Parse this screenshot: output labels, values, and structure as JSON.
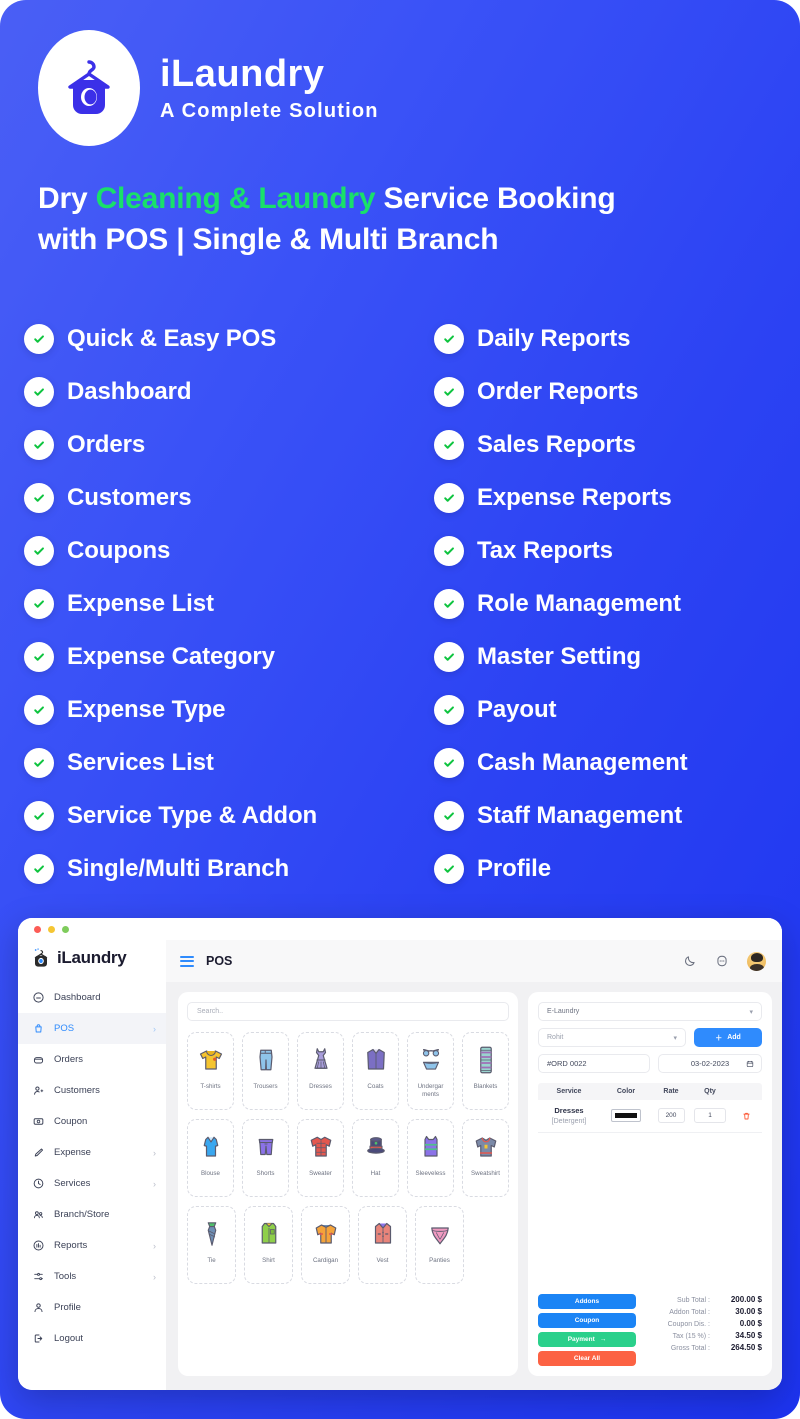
{
  "brand": {
    "logo_icon": "laundry-bag-hanger-icon",
    "name": "iLaundry",
    "tagline": "A Complete Solution"
  },
  "headline": {
    "part1": "Dry ",
    "highlight": "Cleaning & Laundry",
    "part2": " Service Booking",
    "line2": "with POS | Single & Multi Branch",
    "highlight_color": "#19e06a",
    "text_color": "#ffffff"
  },
  "features": {
    "check_icon": "check-circle-icon",
    "left": [
      "Quick & Easy POS",
      "Dashboard",
      "Orders",
      "Customers",
      "Coupons",
      "Expense List",
      "Expense Category",
      "Expense Type",
      "Services List",
      "Service Type & Addon",
      "Single/Multi Branch"
    ],
    "right": [
      "Daily Reports",
      "Order Reports",
      "Sales Reports",
      "Expense Reports",
      "Tax Reports",
      "Role Management",
      "Master Setting",
      "Payout",
      "Cash Management",
      "Staff Management",
      "Profile"
    ]
  },
  "app": {
    "window_dots": [
      "close",
      "minimize",
      "maximize"
    ],
    "sidebar": {
      "brand_name": "iLaundry",
      "brand_icon": "laundry-bag-icon",
      "items": [
        {
          "label": "Dashboard",
          "icon": "dashboard-icon",
          "active": false,
          "chevron": ""
        },
        {
          "label": "POS",
          "icon": "pos-bag-icon",
          "active": true,
          "chevron": "›"
        },
        {
          "label": "Orders",
          "icon": "orders-basket-icon",
          "active": false,
          "chevron": ""
        },
        {
          "label": "Customers",
          "icon": "customers-icon",
          "active": false,
          "chevron": ""
        },
        {
          "label": "Coupon",
          "icon": "coupon-icon",
          "active": false,
          "chevron": ""
        },
        {
          "label": "Expense",
          "icon": "expense-pen-icon",
          "active": false,
          "chevron": "›"
        },
        {
          "label": "Services",
          "icon": "services-clock-icon",
          "active": false,
          "chevron": "›"
        },
        {
          "label": "Branch/Store",
          "icon": "branch-group-icon",
          "active": false,
          "chevron": ""
        },
        {
          "label": "Reports",
          "icon": "reports-chart-icon",
          "active": false,
          "chevron": "›"
        },
        {
          "label": "Tools",
          "icon": "tools-sliders-icon",
          "active": false,
          "chevron": "›"
        },
        {
          "label": "Profile",
          "icon": "profile-user-icon",
          "active": false,
          "chevron": ""
        },
        {
          "label": "Logout",
          "icon": "logout-icon",
          "active": false,
          "chevron": ""
        }
      ]
    },
    "topbar": {
      "menu_icon": "hamburger-icon",
      "title": "POS",
      "dark_mode_icon": "moon-icon",
      "messages_icon": "message-icon",
      "avatar": "user-avatar"
    },
    "products_panel": {
      "search_placeholder": "Search..",
      "rows": [
        [
          {
            "name": "T-shirts",
            "icon": "tshirt-icon"
          },
          {
            "name": "Trousers",
            "icon": "trousers-icon"
          },
          {
            "name": "Dresses",
            "icon": "dress-icon"
          },
          {
            "name": "Coats",
            "icon": "coat-icon"
          },
          {
            "name": "Undergar ments",
            "icon": "underwear-icon"
          },
          {
            "name": "Blankets",
            "icon": "blanket-icon"
          }
        ],
        [
          {
            "name": "Blouse",
            "icon": "blouse-icon"
          },
          {
            "name": "Shorts",
            "icon": "shorts-icon"
          },
          {
            "name": "Sweater",
            "icon": "sweater-icon"
          },
          {
            "name": "Hat",
            "icon": "hat-icon"
          },
          {
            "name": "Sleeveless",
            "icon": "sleeveless-icon"
          },
          {
            "name": "Sweatshirt",
            "icon": "sweatshirt-icon"
          }
        ],
        [
          {
            "name": "Tie",
            "icon": "tie-icon"
          },
          {
            "name": "Shirt",
            "icon": "shirt-icon"
          },
          {
            "name": "Cardigan",
            "icon": "cardigan-icon"
          },
          {
            "name": "Vest",
            "icon": "vest-icon"
          },
          {
            "name": "Panties",
            "icon": "panties-icon"
          }
        ]
      ]
    },
    "cart_panel": {
      "service_select": "E-Laundry",
      "customer_select": "Rohit",
      "add_button": "Add",
      "add_icon": "plus-icon",
      "order_no": "#ORD 0022",
      "order_date": "03-02-2023",
      "calendar_icon": "calendar-icon",
      "table_headers": [
        "Service",
        "Color",
        "Rate",
        "Qty",
        ""
      ],
      "rows": [
        {
          "service": "Dresses",
          "service_sub": "[Detergent]",
          "color": "#111111",
          "rate": "200",
          "qty": "1",
          "delete_icon": "trash-icon"
        }
      ],
      "buttons": [
        {
          "label": "Addons",
          "color": "#1b84f5",
          "icon": ""
        },
        {
          "label": "Coupon",
          "color": "#1b84f5",
          "icon": ""
        },
        {
          "label": "Payment",
          "color": "#2ad08b",
          "icon": "→"
        },
        {
          "label": "Clear All",
          "color": "#fc6243",
          "icon": ""
        }
      ],
      "totals": [
        {
          "label": "Sub Total :",
          "value": "200.00 $"
        },
        {
          "label": "Addon Total :",
          "value": "30.00 $"
        },
        {
          "label": "Coupon Dis. :",
          "value": "0.00 $"
        },
        {
          "label": "Tax (15 %) :",
          "value": "34.50 $"
        },
        {
          "label": "Gross Total :",
          "value": "264.50 $"
        }
      ]
    }
  }
}
